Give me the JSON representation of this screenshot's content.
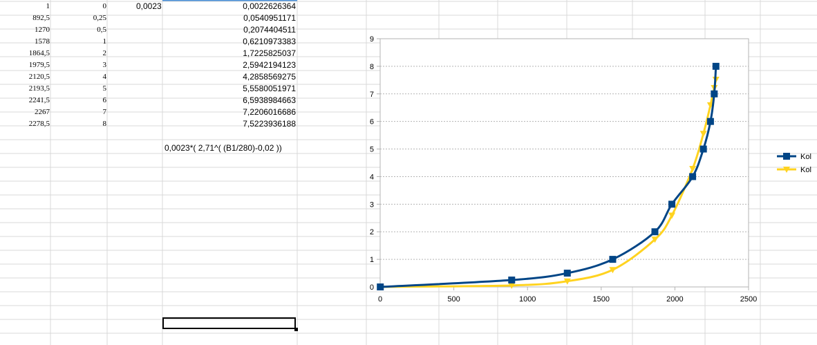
{
  "sheet": {
    "rows": [
      {
        "a": "1",
        "b": "0",
        "c": "0,0023",
        "d": "0,0022626364"
      },
      {
        "a": "892,5",
        "b": "0,25",
        "c": "",
        "d": "0,0540951171"
      },
      {
        "a": "1270",
        "b": "0,5",
        "c": "",
        "d": "0,2074404511"
      },
      {
        "a": "1578",
        "b": "1",
        "c": "",
        "d": "0,6210973383"
      },
      {
        "a": "1864,5",
        "b": "2",
        "c": "",
        "d": "1,7225825037"
      },
      {
        "a": "1979,5",
        "b": "3",
        "c": "",
        "d": "2,5942194123"
      },
      {
        "a": "2120,5",
        "b": "4",
        "c": "",
        "d": "4,2858569275"
      },
      {
        "a": "2193,5",
        "b": "5",
        "c": "",
        "d": "5,5580051971"
      },
      {
        "a": "2241,5",
        "b": "6",
        "c": "",
        "d": "6,5938984663"
      },
      {
        "a": "2267",
        "b": "7",
        "c": "",
        "d": "7,2206016686"
      },
      {
        "a": "2278,5",
        "b": "8",
        "c": "",
        "d": "7,5223936188"
      }
    ],
    "formula_text": "0,0023*( 2,71^( (B1/280)-0,02 ))"
  },
  "chart_data": {
    "type": "line",
    "x_ticks": [
      "0",
      "500",
      "1000",
      "1500",
      "2000",
      "2500"
    ],
    "y_ticks": [
      "0",
      "1",
      "2",
      "3",
      "4",
      "5",
      "6",
      "7",
      "8",
      "9"
    ],
    "xlim": [
      0,
      2500
    ],
    "ylim": [
      0,
      9
    ],
    "grid": "horizontal",
    "legend_position": "right",
    "series": [
      {
        "name": "Kol",
        "color": "#004586",
        "marker": "square",
        "x": [
          1,
          892.5,
          1270,
          1578,
          1864.5,
          1979.5,
          2120.5,
          2193.5,
          2241.5,
          2267,
          2278.5
        ],
        "y": [
          0,
          0.25,
          0.5,
          1,
          2,
          3,
          4,
          5,
          6,
          7,
          8
        ]
      },
      {
        "name": "Kol",
        "color": "#ffd320",
        "marker": "triangle-down",
        "x": [
          1,
          892.5,
          1270,
          1578,
          1864.5,
          1979.5,
          2120.5,
          2193.5,
          2241.5,
          2267,
          2278.5
        ],
        "y": [
          0.0022626364,
          0.0540951171,
          0.2074404511,
          0.6210973383,
          1.7225825037,
          2.5942194123,
          4.2858569275,
          5.5580051971,
          6.5938984663,
          7.2206016686,
          7.5223936188
        ]
      }
    ]
  }
}
